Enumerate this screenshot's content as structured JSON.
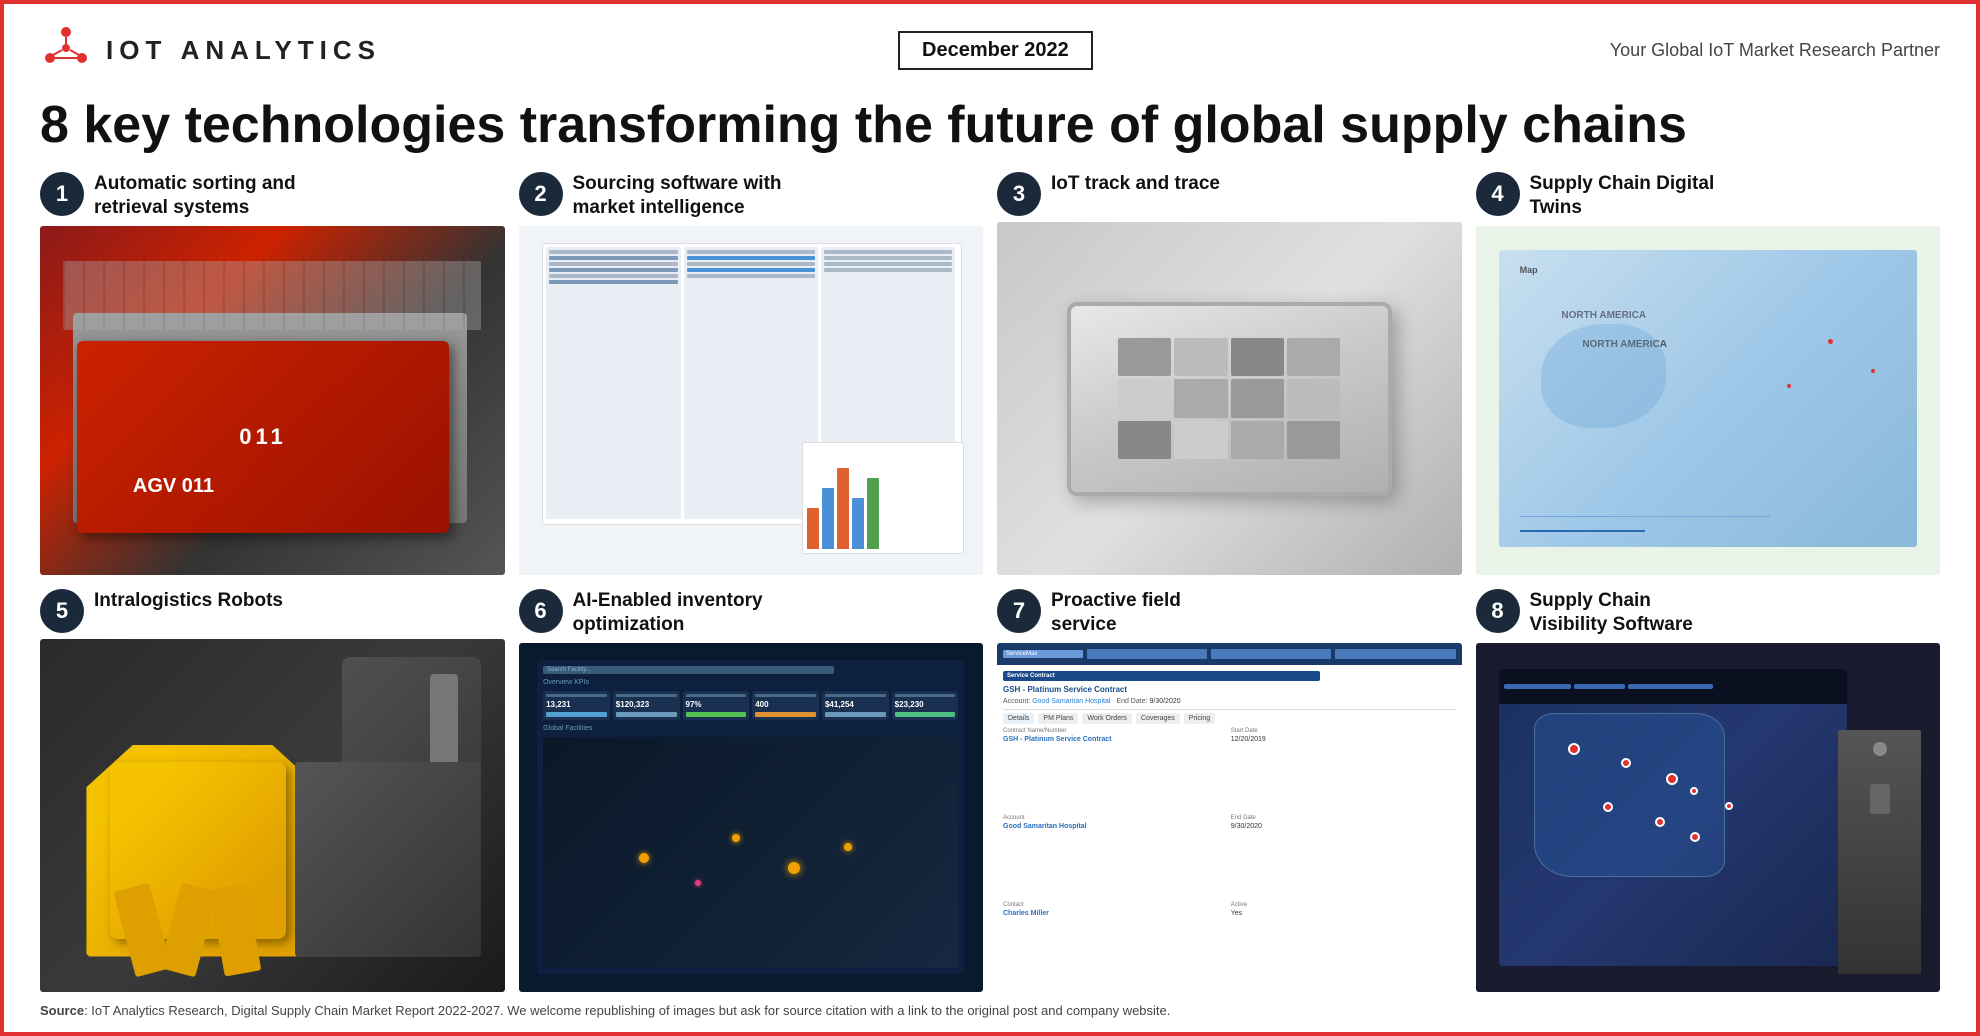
{
  "header": {
    "logo_text_iot": "IOT",
    "logo_text_analytics": "ANALYTICS",
    "date": "December 2022",
    "tagline": "Your Global IoT Market Research Partner"
  },
  "main_title": "8 key technologies transforming the future of global supply chains",
  "cards": [
    {
      "number": "1",
      "title": "Automatic sorting and\nretrieval systems"
    },
    {
      "number": "2",
      "title": "Sourcing software with\nmarket intelligence"
    },
    {
      "number": "3",
      "title": "IoT track and trace"
    },
    {
      "number": "4",
      "title": "Supply Chain Digital\nTwins"
    },
    {
      "number": "5",
      "title": "Intralogistics Robots"
    },
    {
      "number": "6",
      "title": "AI-Enabled inventory\noptimization"
    },
    {
      "number": "7",
      "title": "Proactive field\nservice"
    },
    {
      "number": "8",
      "title": "Supply Chain\nVisibility Software"
    }
  ],
  "footer": {
    "label": "Source",
    "text": ": IoT Analytics Research, Digital Supply Chain Market Report 2022-2027. We welcome republishing of images but ask for source citation with a link to the original post and company website."
  }
}
